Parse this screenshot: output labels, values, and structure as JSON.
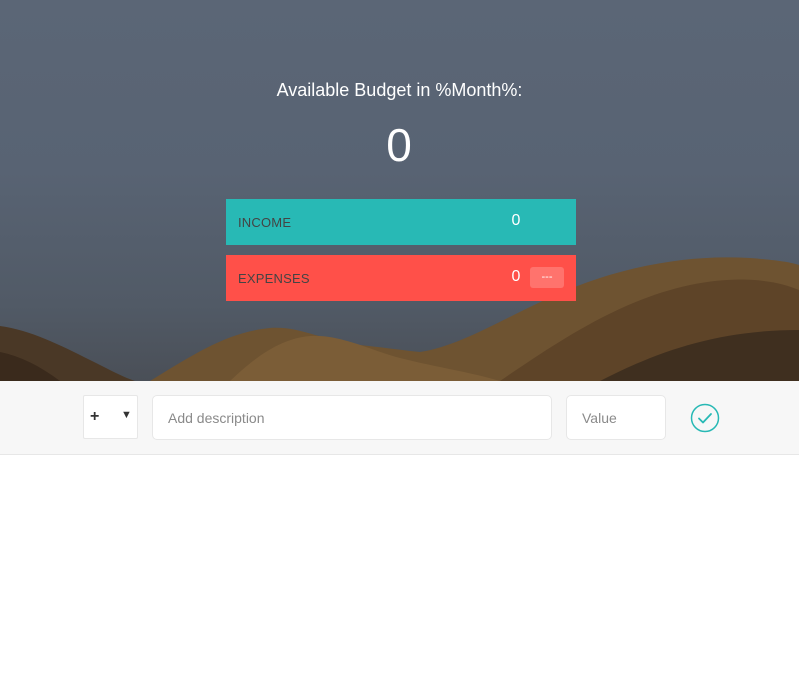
{
  "budget": {
    "title": "Available Budget in %Month%:",
    "value": "0"
  },
  "income": {
    "label": "INCOME",
    "value": "0"
  },
  "expenses": {
    "label": "EXPENSES",
    "value": "0",
    "percentage": "---"
  },
  "add": {
    "type_selected": "+",
    "description_placeholder": "Add description",
    "value_placeholder": "Value",
    "submit_icon": "checkmark-circle-icon"
  },
  "colors": {
    "income": "#28b9b5",
    "expenses": "#ff5049",
    "accent": "#28b9b5"
  }
}
